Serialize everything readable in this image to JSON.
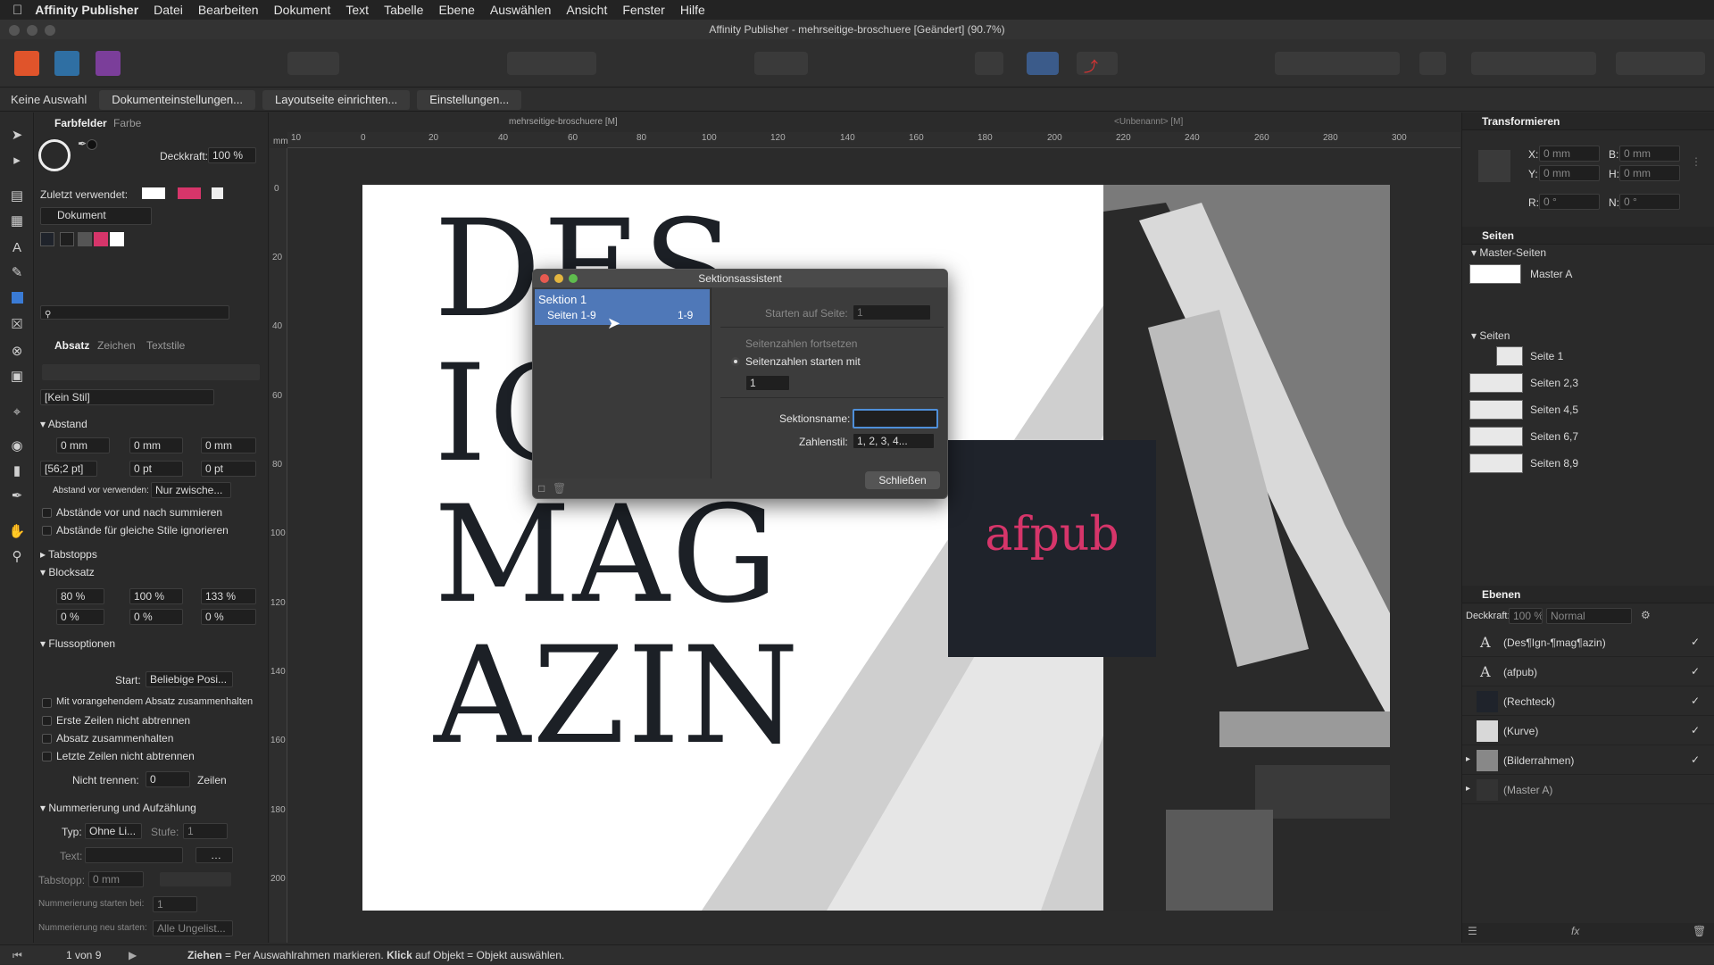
{
  "menubar": {
    "app": "Affinity Publisher",
    "items": [
      "Datei",
      "Bearbeiten",
      "Dokument",
      "Text",
      "Tabelle",
      "Ebene",
      "Auswählen",
      "Ansicht",
      "Fenster",
      "Hilfe"
    ]
  },
  "window": {
    "title": "Affinity Publisher - mehrseitige-broschuere [Geändert] (90.7%)"
  },
  "context": {
    "selection": "Keine Auswahl",
    "buttons": [
      "Dokumenteinstellungen...",
      "Layoutseite einrichten...",
      "Einstellungen..."
    ]
  },
  "doc_tabs": {
    "left": "mehrseitige-broschuere [M]",
    "right": "<Unbenannt> [M]"
  },
  "ruler": {
    "unit": "mm",
    "h_ticks": [
      "10",
      "0",
      "20",
      "40",
      "60",
      "80",
      "100",
      "120",
      "140",
      "160",
      "180",
      "200",
      "220",
      "240",
      "260",
      "280",
      "300"
    ],
    "v_ticks": [
      "0",
      "20",
      "40",
      "60",
      "80",
      "100",
      "120",
      "140",
      "160",
      "180",
      "200"
    ]
  },
  "swatches": {
    "tab1": "Farbfelder",
    "tab2": "Farbe",
    "opacity_label": "Deckkraft:",
    "opacity_value": "100 %",
    "recent_label": "Zuletzt verwendet:",
    "palette": "Dokument",
    "colors": {
      "pink": "#d6356a",
      "dark": "#1f232b",
      "grey": "#555555",
      "white": "#ffffff"
    }
  },
  "paragraph": {
    "tabs": [
      "Absatz",
      "Zeichen",
      "Textstile"
    ],
    "style": "[Kein Stil]",
    "spacing_title": "Abstand",
    "indent1": "0 mm",
    "indent2": "0 mm",
    "indent3": "0 mm",
    "leading": "[56;2 pt]",
    "space1": "0 pt",
    "space2": "0 pt",
    "space_before_label": "Abstand vor verwenden:",
    "space_before_value": "Nur zwische...",
    "chk1": "Abstände vor und nach summieren",
    "chk2": "Abstände für gleiche Stile ignorieren",
    "tabs_title": "Tabstopps",
    "justify_title": "Blocksatz",
    "j1": "80 %",
    "j2": "100 %",
    "j3": "133 %",
    "j4": "0 %",
    "j5": "0 %",
    "j6": "0 %",
    "flow_title": "Flussoptionen",
    "start_label": "Start:",
    "start_value": "Beliebige Posi...",
    "f1": "Mit vorangehendem Absatz zusammenhalten",
    "f2": "Erste Zeilen nicht abtrennen",
    "f3": "Absatz zusammenhalten",
    "f4": "Letzte Zeilen nicht abtrennen",
    "nosplit_label": "Nicht trennen:",
    "nosplit_value": "0",
    "nosplit_unit": "Zeilen",
    "num_title": "Nummerierung und Aufzählung",
    "type_label": "Typ:",
    "type_value": "Ohne Li...",
    "level_label": "Stufe:",
    "level_value": "1",
    "text_label": "Text:",
    "tabstop_label": "Tabstopp:",
    "tabstop_value": "0 mm",
    "numstart_label": "Nummerierung starten bei:",
    "numstart_value": "1",
    "restart_label": "Nummerierung neu starten:",
    "restart_value": "Alle Ungelist..."
  },
  "page": {
    "title_lines": [
      "DES",
      "IGN",
      "MAG",
      "AZIN"
    ],
    "badge": "afpub"
  },
  "dialog": {
    "title": "Sektionsassistent",
    "section_name": "Sektion 1",
    "section_pages": "Seiten 1-9",
    "section_range": "1-9",
    "start_label": "Starten auf Seite:",
    "start_value": "1",
    "continue_label": "Seitenzahlen fortsetzen",
    "restart_label": "Seitenzahlen starten mit",
    "restart_value": "1",
    "name_label": "Sektionsname:",
    "name_value": "",
    "style_label": "Zahlenstil:",
    "style_value": "1, 2, 3, 4...",
    "close": "Schließen"
  },
  "transform": {
    "title": "Transformieren",
    "x": "0 mm",
    "y": "0 mm",
    "w": "0 mm",
    "h": "0 mm",
    "r": "0 °",
    "s": "0 °",
    "xl": "X:",
    "yl": "Y:",
    "wl": "B:",
    "hl": "H:",
    "rl": "R:",
    "sl": "N:"
  },
  "pages_panel": {
    "title": "Seiten",
    "masters_title": "Master-Seiten",
    "master": "Master A",
    "pages_title": "Seiten",
    "pages": [
      "Seite 1",
      "Seiten 2,3",
      "Seiten 4,5",
      "Seiten 6,7",
      "Seiten 8,9"
    ]
  },
  "layers": {
    "title": "Ebenen",
    "opacity_label": "Deckkraft:",
    "opacity": "100 %",
    "blend": "Normal",
    "items": [
      "(Des¶Ign-¶mag¶azin)",
      "(afpub)",
      "(Rechteck)",
      "(Kurve)",
      "(Bilderrahmen)",
      "(Master A)"
    ]
  },
  "status": {
    "page": "1 von 9",
    "hint_b1": "Ziehen",
    "hint_t1": " = Per Auswahlrahmen markieren. ",
    "hint_b2": "Klick",
    "hint_t2": " auf Objekt = Objekt auswählen."
  }
}
